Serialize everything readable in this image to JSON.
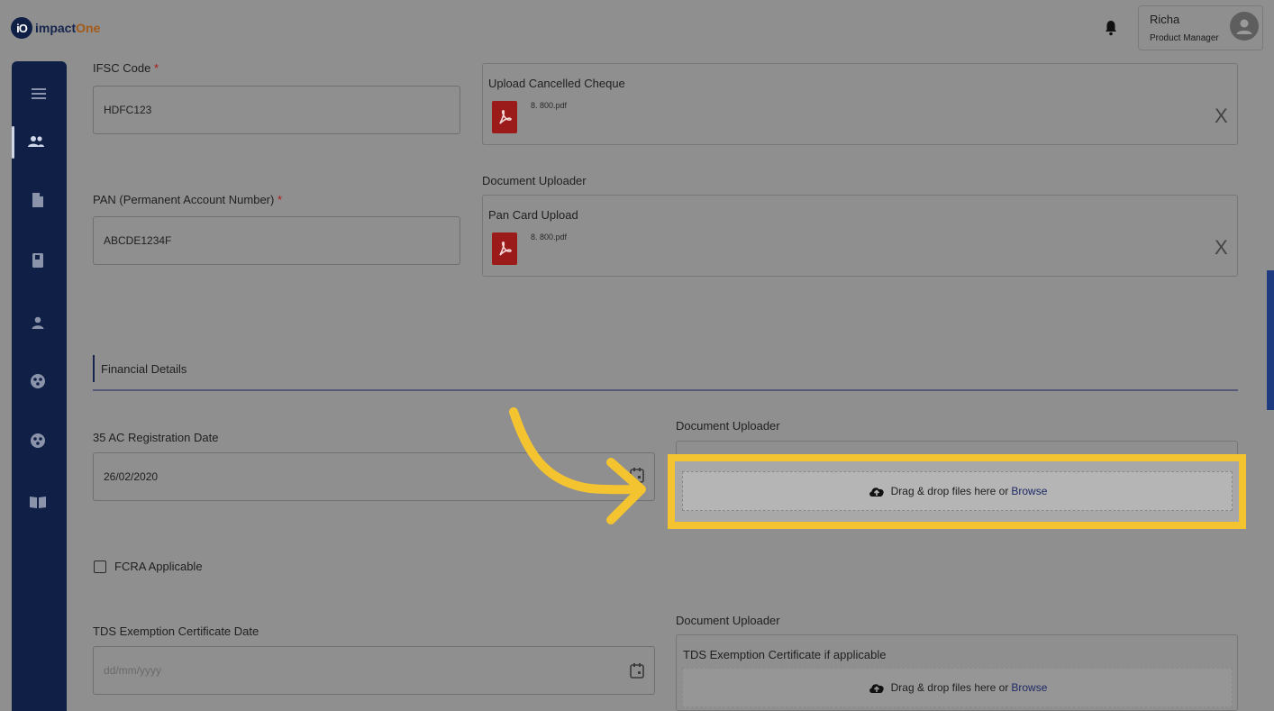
{
  "app": {
    "logo_mark": "iO",
    "logo_text_main": "impact",
    "logo_text_accent": "One"
  },
  "header": {
    "user_name": "Richa",
    "user_role": "Product Manager",
    "icons": [
      "bell-icon",
      "avatar-icon"
    ]
  },
  "sidebar": {
    "items": [
      {
        "icon": "menu-icon"
      },
      {
        "icon": "people-icon",
        "active": true
      },
      {
        "icon": "document-icon"
      },
      {
        "icon": "book-icon"
      },
      {
        "icon": "person-icon"
      },
      {
        "icon": "group-icon"
      },
      {
        "icon": "group-alt-icon"
      },
      {
        "icon": "open-book-icon"
      }
    ]
  },
  "form": {
    "ifsc": {
      "label": "IFSC Code",
      "required_mark": "*",
      "value": "HDFC123"
    },
    "cancelled_cheque": {
      "title": "Upload Cancelled Cheque",
      "file_name": "8. 800.pdf",
      "remove": "X"
    },
    "pan": {
      "label": "PAN (Permanent Account Number)",
      "required_mark": "*",
      "value": "ABCDE1234F"
    },
    "pan_uploader": {
      "section_label": "Document Uploader",
      "title": "Pan Card Upload",
      "file_name": "8. 800.pdf",
      "remove": "X"
    },
    "financial_section": {
      "title": "Financial Details"
    },
    "reg_35ac": {
      "label": "35 AC Registration Date",
      "value": "26/02/2020"
    },
    "reg_35ac_uploader": {
      "section_label": "Document Uploader",
      "dropzone_text": "Drag & drop files here or",
      "dropzone_link": "Browse"
    },
    "fcra": {
      "label": "FCRA Applicable",
      "checked": false
    },
    "tds": {
      "label": "TDS Exemption Certificate Date",
      "placeholder": "dd/mm/yyyy"
    },
    "tds_uploader": {
      "section_label": "Document Uploader",
      "title": "TDS Exemption Certificate if applicable",
      "dropzone_text": "Drag & drop files here or",
      "dropzone_link": "Browse"
    }
  },
  "colors": {
    "sidebar": "#0f1f45",
    "highlight": "#f4c430",
    "arrow": "#f4c430",
    "overlay": "#8f8f8f"
  }
}
